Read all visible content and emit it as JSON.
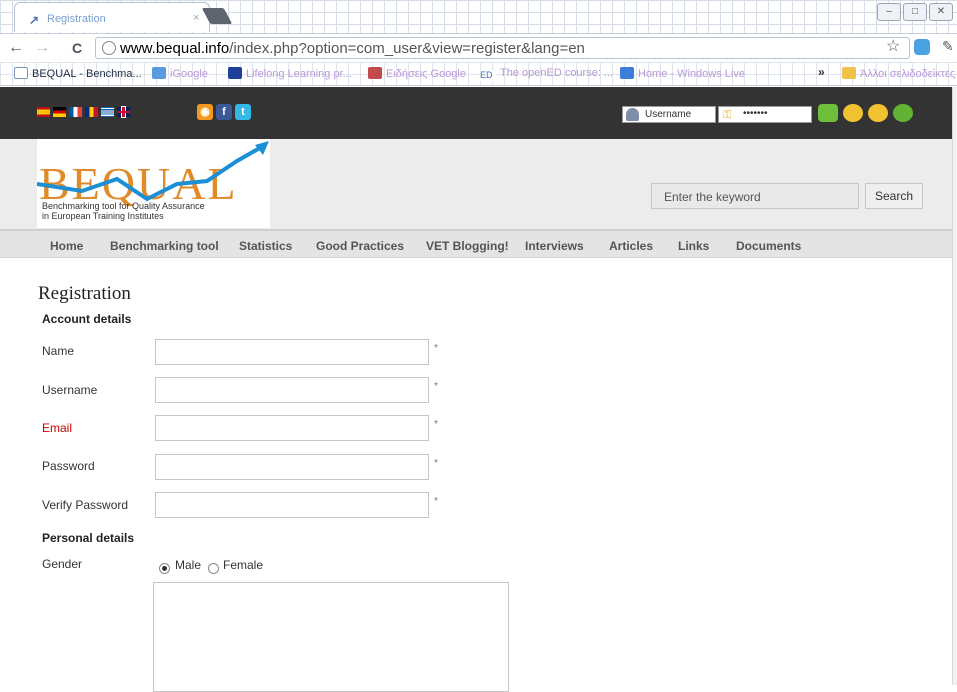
{
  "browser": {
    "tab_title": "Registration",
    "tab_close": "×",
    "url_host": "www.bequal.info",
    "url_rest": "/index.php?option=com_user&view=register&lang=en",
    "nav": {
      "back": "←",
      "forward": "→",
      "reload": "C"
    },
    "window_controls": [
      "–",
      "□",
      "✕"
    ],
    "bookmarks": [
      "BEQUAL - Benchma...",
      "iGoogle",
      "Lifelong Learning pr...",
      "Ειδήσεις Google",
      "The openED course: ...",
      "Home - Windows Live",
      "Άλλοι σελιδοδείκτες"
    ],
    "bookmarks_more": "»",
    "star": "☆",
    "wrench": "🔧"
  },
  "site": {
    "social": [
      "rss",
      "f",
      "t"
    ],
    "login": {
      "username_placeholder": "Username",
      "password_value": "•••••••"
    },
    "logo": {
      "text": "BEQUAL",
      "tagline_1": "Benchmarking tool for Quality Assurance",
      "tagline_2": "in European Training Institutes"
    },
    "search": {
      "placeholder": "Enter the keyword",
      "button": "Search"
    },
    "menu": [
      "Home",
      "Benchmarking tool",
      "Statistics",
      "Good Practices",
      "VET Blogging!",
      "Interviews",
      "Articles",
      "Links",
      "Documents"
    ]
  },
  "form": {
    "title": "Registration",
    "account_section": "Account details",
    "fields": [
      {
        "label": "Name",
        "required": "*"
      },
      {
        "label": "Username",
        "required": "*"
      },
      {
        "label": "Email",
        "required": "*"
      },
      {
        "label": "Password",
        "required": "*"
      },
      {
        "label": "Verify Password",
        "required": "*"
      }
    ],
    "personal_section": "Personal details",
    "gender_label": "Gender",
    "gender_options": [
      "Male",
      "Female"
    ],
    "gender_selected": "Male"
  },
  "colors": {
    "accent_blue": "#1a8fd6",
    "logo_orange": "#e08a2a",
    "required_red": "#cc0000",
    "top_bar": "#333333"
  }
}
